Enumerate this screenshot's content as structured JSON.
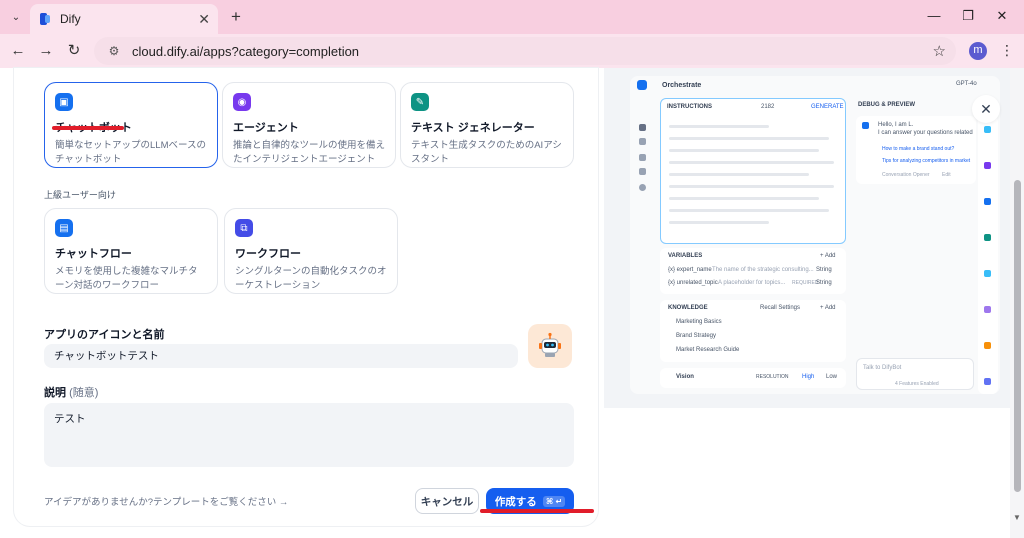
{
  "browser": {
    "tab_title": "Dify",
    "url": "cloud.dify.ai/apps?category=completion",
    "profile_initial": "m"
  },
  "app_types": [
    {
      "title": "チャットボット",
      "desc": "簡単なセットアップのLLMベースのチャットボット",
      "icon": "chatbot-icon",
      "color": "#1570ef"
    },
    {
      "title": "エージェント",
      "desc": "推論と自律的なツールの使用を備えたインテリジェントエージェント",
      "icon": "agent-icon",
      "color": "#7839ee"
    },
    {
      "title": "テキスト ジェネレーター",
      "desc": "テキスト生成タスクのためのAIアシスタント",
      "icon": "text-generator-icon",
      "color": "#0e9384"
    }
  ],
  "advanced_label": "上級ユーザー向け",
  "advanced_types": [
    {
      "title": "チャットフロー",
      "desc": "メモリを使用した複雑なマルチターン対話のワークフロー",
      "icon": "chatflow-icon",
      "color": "#1570ef"
    },
    {
      "title": "ワークフロー",
      "desc": "シングルターンの自動化タスクのオーケストレーション",
      "icon": "workflow-icon",
      "color": "#444ce7"
    }
  ],
  "form": {
    "name_label": "アプリのアイコンと名前",
    "name_value": "チャットボットテスト",
    "desc_label": "説明",
    "desc_optional": "(随意)",
    "desc_value": "テスト"
  },
  "footer": {
    "template_link": "アイデアがありませんか?テンプレートをご覧ください",
    "cancel": "キャンセル",
    "create": "作成する",
    "create_kbd": "⌘ ↵"
  },
  "preview": {
    "orchestrate": "Orchestrate",
    "model": "GPT-4o",
    "instructions": "INSTRUCTIONS",
    "token_count": "2182",
    "generate": "GENERATE",
    "debug": "DEBUG & PREVIEW",
    "greeting1": "Hello, I am L.",
    "greeting2": "I can answer your questions related",
    "suggest1": "How to make a brand stand out?",
    "suggest2": "Tips for analyzing competitors in market",
    "opener": "Conversation Opener",
    "edit": "Edit",
    "variables": "VARIABLES",
    "add": "+ Add",
    "var1_name": "{x} expert_name",
    "var1_desc": "The name of the strategic consulting...",
    "var1_type": "String",
    "var2_name": "{x} unrelated_topic",
    "var2_desc": "A placeholder for topics...",
    "var2_tag": "REQUIRED",
    "var2_type": "String",
    "knowledge": "KNOWLEDGE",
    "recall": "Recall Settings",
    "kb1": "Marketing Basics",
    "kb2": "Brand Strategy",
    "kb3": "Market Research Guide",
    "vision": "Vision",
    "resolution": "RESOLUTION",
    "high": "High",
    "low": "Low",
    "talk": "Talk to DifyBot",
    "features": "4 Features Enabled"
  }
}
